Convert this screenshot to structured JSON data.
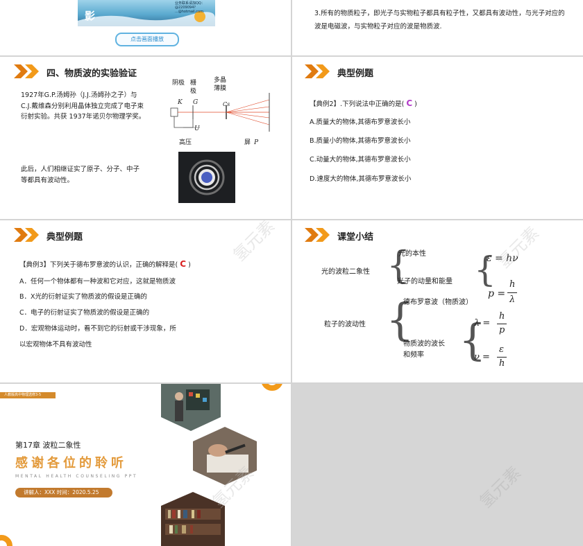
{
  "slide1": {
    "banner_text": "点击画面播放",
    "banner_contact_lines": [
      "业务联系请加QQ：",
      "@2209094?",
      "...@hotmail.com"
    ]
  },
  "slide2": {
    "text": "3.所有的物质粒子，即光子与实物粒子都具有粒子性，又都具有波动性，与光子对应的波是电磁波，与实物粒子对应的波是物质波."
  },
  "slide3": {
    "title": "四、物质波的实验验证",
    "para1": "1927年G.P.汤姆孙（J.J.汤姆孙之子）与 C.J.戴维森分别利用晶体独立完成了电子束衍射实验。共获 1937年诺贝尔物理学奖。",
    "para2": "此后，人们相继证实了原子、分子、中子等都具有波动性。",
    "diagram": {
      "label_cathode": "阴极",
      "label_grid_1": "栅",
      "label_grid_2": "极",
      "label_film_1": "多晶",
      "label_film_2": "薄膜",
      "K": "K",
      "G": "G",
      "Cs": "Cs",
      "U": "U",
      "high_voltage": "高压",
      "screen": "屏",
      "P": "P"
    }
  },
  "slide4": {
    "title": "典型例题",
    "question_prefix": "【典例2】.下列说法中正确的是(",
    "answer": "C",
    "question_suffix": ")",
    "options": [
      "A.质量大的物体,其德布罗意波长小",
      "B.质量小的物体,其德布罗意波长小",
      "C.动量大的物体,其德布罗意波长小",
      "D.速度大的物体,其德布罗意波长小"
    ]
  },
  "slide5": {
    "title": "典型例题",
    "question_prefix": "【典例3】下列关于德布罗意波的认识，正确的解释是(",
    "answer": "C",
    "question_suffix": ")",
    "options": [
      "A．任何一个物体都有一种波和它对应，这就是物质波",
      "B．X光的衍射证实了物质波的假设是正确的",
      "C．电子的衍射证实了物质波的假设是正确的",
      "D．宏观物体运动时，看不到它的衍射或干涉现象，所",
      "以宏观物体不具有波动性"
    ]
  },
  "slide6": {
    "title": "课堂小结",
    "left1": "光的波粒二象性",
    "branch1a": "光的本性",
    "branch1b": "光子的动量和能量",
    "eq1": "ε = hν",
    "eq2_lhs": "p =",
    "eq2_num": "h",
    "eq2_den": "λ",
    "left2": "粒子的波动性",
    "branch2a": "德布罗意波（物质波）",
    "branch2b_1": "物质波的波长",
    "branch2b_2": "和频率",
    "eq3_lhs": "λ =",
    "eq3_num": "h",
    "eq3_den": "p",
    "eq4_lhs": "ν =",
    "eq4_num": "ε",
    "eq4_den": "h"
  },
  "slide7": {
    "top_tag": "人教版高中物理选修3-5",
    "chapter": "第17章  波粒二象性",
    "thanks": "感谢各位的聆听",
    "subtitle": "MENTAL HEALTH COUNSELING PPT",
    "presenter": "讲解人：XXX  时间：2020.5.25"
  },
  "watermark": "氢元素",
  "colors": {
    "accent_orange": "#f29a1a",
    "accent_orange_dark": "#e07b10",
    "thanks_orange": "#e39a3b",
    "presenter_bg": "#c27a2e",
    "answer_purple": "#b33cc9",
    "answer_red": "#d81e1e"
  }
}
